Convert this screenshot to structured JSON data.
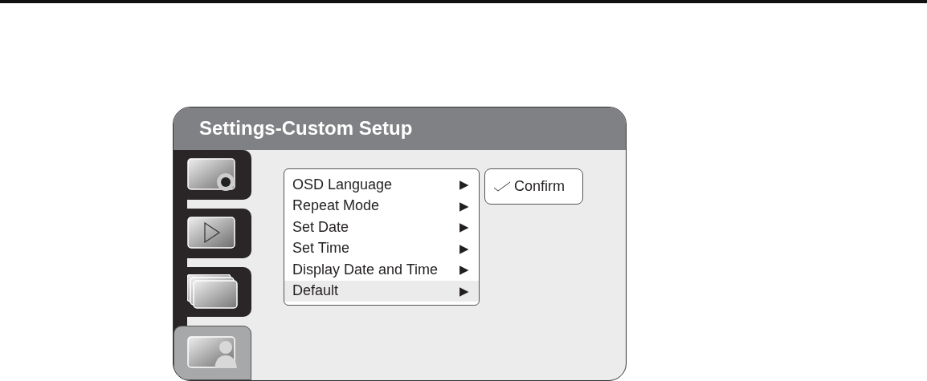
{
  "window": {
    "title": "Settings-Custom Setup"
  },
  "side_tabs": [
    {
      "kind": "gear",
      "selected": false
    },
    {
      "kind": "play",
      "selected": false
    },
    {
      "kind": "stack",
      "selected": false
    },
    {
      "kind": "person",
      "selected": true
    }
  ],
  "menu": [
    {
      "label": "OSD Language",
      "arrow": "▶",
      "selected": false
    },
    {
      "label": "Repeat Mode",
      "arrow": "▶",
      "selected": false
    },
    {
      "label": "Set Date",
      "arrow": "▶",
      "selected": false
    },
    {
      "label": "Set Time",
      "arrow": "▶",
      "selected": false
    },
    {
      "label": "Display Date and Time",
      "arrow": "▶",
      "selected": false
    },
    {
      "label": "Default",
      "arrow": "▶",
      "selected": true
    }
  ],
  "confirm": {
    "label": "Confirm",
    "checked": true
  }
}
